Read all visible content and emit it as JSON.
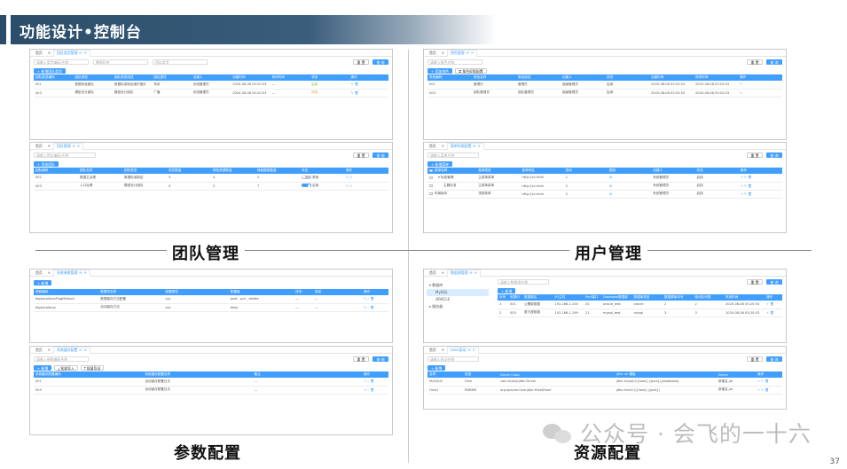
{
  "header": {
    "title": "功能设计•控制台"
  },
  "sections": {
    "team": "团队管理",
    "user": "用户管理",
    "param": "参数配置",
    "resource": "资源配置"
  },
  "page_number": "37",
  "watermark": "公众号 · 会飞的一十六",
  "colors": {
    "header_bar": "#2b4d69",
    "primary": "#409eff"
  },
  "panels": {
    "team_type": {
      "tabs": [
        "首页",
        "团队类型管理"
      ],
      "search": [
        "请输入类型编码/名称",
        "数据状态",
        "团队类型"
      ],
      "buttons": {
        "reset": "重 置",
        "query": "查 询",
        "add": "新增团队类型"
      },
      "columns": [
        "团队类型编码",
        "团队类型",
        "团队类型描述",
        "团队属性",
        "创建人",
        "创建时间",
        "修改时间",
        "状态",
        "操作"
      ],
      "rows": [
        [
          "001",
          "数据标准团队",
          "数据标准制定维护团队",
          "有序",
          "系统管理员",
          "2020-08-08 05:20:53",
          "—",
          "启用"
        ],
        [
          "003",
          "模型设计团队",
          "模型设计团队",
          "广播",
          "系统管理员",
          "2020-08-08 05:20:53",
          "—",
          "停用"
        ]
      ]
    },
    "team_mgmt": {
      "tabs": [
        "首页",
        "团队管理"
      ],
      "search": [
        "请输入团队编码/名称"
      ],
      "buttons": {
        "reset": "重 置",
        "query": "查 询",
        "add": "添加团队"
      },
      "columns": [
        "团队编码",
        "团队名称",
        "团队类型",
        "成员数量",
        "授权资源数量",
        "授权模型数量",
        "状态",
        "操作"
      ],
      "rows": [
        [
          "001",
          "数据主治理",
          "数据标准制定",
          "3",
          "4",
          "2",
          "禁用"
        ],
        [
          "003",
          "入口治理",
          "模型设计团队",
          "4",
          "5",
          "7",
          "启用"
        ]
      ]
    },
    "role_mgmt": {
      "tabs": [
        "首页",
        "角色管理"
      ],
      "search": [
        "请输入角色名称"
      ],
      "buttons": {
        "reset": "重 置",
        "query": "查 询",
        "add": "添加角色",
        "perm": "角色权限配置"
      },
      "columns": [
        "角色编码",
        "角色名称",
        "角色描述",
        "创建人",
        "状态",
        "创建时间",
        "修改时间",
        "操作"
      ],
      "rows": [
        [
          "001",
          "管理员",
          "管理员",
          "超级管理员",
          "启用",
          "2020-08-08 05:20:53",
          "2020-08-08 05:20:53"
        ],
        [
          "003",
          "团队管理员",
          "团队管理员",
          "超级管理员",
          "启用",
          "2020-08-08 05:20:53",
          "2020-08-08 05:20:53"
        ]
      ]
    },
    "menu_mgmt": {
      "tabs": [
        "首页",
        "菜单权限配置"
      ],
      "search": [
        "请输入菜单名称"
      ],
      "buttons": {
        "reset": "重 置",
        "query": "查 询",
        "add": "新增菜单"
      },
      "columns": [
        "菜单名称",
        "菜单类型",
        "菜单地址",
        "排序",
        "图标",
        "创建人",
        "状态",
        "操作"
      ],
      "rows": [
        [
          "▾ 标准管理",
          "主菜单菜单",
          "http://xx.html",
          "1",
          "⚙",
          "系统管理员",
          "启用"
        ],
        [
          "主题标准",
          "主菜单菜单",
          "http://xx.html",
          "2",
          "⚙",
          "系统管理员",
          "启用"
        ],
        [
          "布局版本",
          "顶部菜单",
          "http://xx.html",
          "2",
          "⚙",
          "系统管理员",
          "启用"
        ]
      ]
    },
    "sys_param": {
      "tabs": [
        "首页",
        "系统参数管理"
      ],
      "buttons": {
        "add": "新增"
      },
      "columns": [
        "参数编码",
        "配置项名称",
        "配置类型",
        "配置值",
        "排序",
        "描述",
        "操作"
      ],
      "rows": [
        [
          "bigAutoSaveFlagMethod",
          "数据保存方法配置",
          "sys",
          "post , put , delete",
          "—",
          "—"
        ],
        [
          "bigAutoSave",
          "自动保存方法",
          "sys",
          "false",
          "—",
          "—"
        ]
      ]
    },
    "cache_param": {
      "tabs": [
        "首页",
        "系统缓存配置"
      ],
      "search": [
        "请输入参数编码名称"
      ],
      "buttons": {
        "reset": "重 置",
        "query": "查 询",
        "add": "新增",
        "import": "批量导入",
        "export": "批量导出"
      },
      "columns": [
        "系统缓存配置编码",
        "系统缓存配置名称",
        "备注",
        "操作"
      ],
      "rows": [
        [
          "001",
          "自动保存配置日志",
          "—"
        ],
        [
          "003",
          "自动保存配置日志",
          "—"
        ]
      ]
    },
    "datasource": {
      "tabs": [
        "首页",
        "数据源管理"
      ],
      "tree": [
        "数据库",
        "MySQL",
        "ORACLE",
        "服务器"
      ],
      "search": [
        "请输入数据源名称"
      ],
      "buttons": {
        "reset": "重 置",
        "query": "查 询",
        "add": "新增"
      },
      "columns": [
        "序号",
        "资源ID",
        "数据源名",
        "IP/主机",
        "Port端口",
        "Database数据库",
        "数据库类型",
        "数据源版本号",
        "驱动队列数",
        "采用时间",
        "操作"
      ],
      "rows": [
        [
          "1",
          "001",
          "公署新数据",
          "192.168.1.100",
          "20",
          "oracle_test",
          "oracle",
          "2",
          "2",
          "2020-08-08 05:20:53"
        ],
        [
          "2",
          "003",
          "更方便数据",
          "192.168.1.199",
          "21",
          "mysql_test",
          "mysql",
          "3",
          "3",
          "2020-08-08 05:20:53"
        ]
      ]
    },
    "jdbc": {
      "tabs": [
        "首页",
        "JDBC驱动"
      ],
      "search": [
        "请输入驱动名称"
      ],
      "buttons": {
        "reset": "重 置",
        "query": "查 询",
        "add": "新增"
      },
      "columns": [
        "名称",
        "类型",
        "Driver Class",
        "jdbc url 模板",
        "Driver",
        "操作"
      ],
      "rows": [
        [
          "MySQL8",
          "Hive",
          "com.mysql.jdbc.Driver",
          "jdbc:mysql://{host}:{port}/{database}",
          "新建名.jar"
        ],
        [
          "Hive1",
          "RDBMS",
          "org.apache.hive.jdbc.HiveDriver",
          "jdbc:hive2://{host}:{port}/",
          "新建名.jar"
        ]
      ]
    }
  }
}
